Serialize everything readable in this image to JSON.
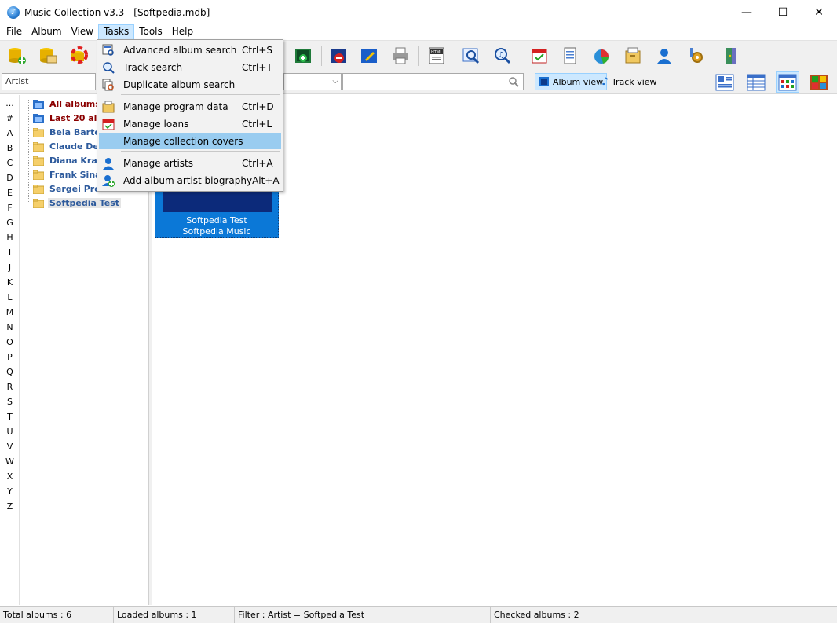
{
  "window": {
    "title": "Music Collection v3.3 - [Softpedia.mdb]",
    "minimize": "—",
    "maximize": "☐",
    "close": "✕"
  },
  "menubar": {
    "items": [
      "File",
      "Album",
      "View",
      "Tasks",
      "Tools",
      "Help"
    ],
    "active": "Tasks"
  },
  "filterbar": {
    "field_value": "Artist",
    "search_placeholder": "",
    "album_view_label": "Album view",
    "track_view_label": "Track view"
  },
  "alphabet": [
    "...",
    "#",
    "A",
    "B",
    "C",
    "D",
    "E",
    "F",
    "G",
    "H",
    "I",
    "J",
    "K",
    "L",
    "M",
    "N",
    "O",
    "P",
    "Q",
    "R",
    "S",
    "T",
    "U",
    "V",
    "W",
    "X",
    "Y",
    "Z"
  ],
  "tree": {
    "items": [
      {
        "label": "All albums",
        "style": "red"
      },
      {
        "label": "Last 20 albu",
        "style": "red"
      },
      {
        "label": "Bela Bartok",
        "style": "blue"
      },
      {
        "label": "Claude Debu",
        "style": "blue"
      },
      {
        "label": "Diana Krall",
        "style": "blue"
      },
      {
        "label": "Frank Sinat",
        "style": "blue"
      },
      {
        "label": "Sergei Prok",
        "style": "blue"
      },
      {
        "label": "Softpedia Test",
        "style": "blue"
      }
    ]
  },
  "album": {
    "title": "Softpedia Test",
    "artist": "Softpedia Music"
  },
  "tasks_menu": {
    "items": [
      {
        "label": "Advanced album search",
        "shortcut": "Ctrl+S",
        "icon": "advanced-search-icon"
      },
      {
        "label": "Track search",
        "shortcut": "Ctrl+T",
        "icon": "track-search-icon"
      },
      {
        "label": "Duplicate album search",
        "shortcut": "",
        "icon": "duplicate-search-icon"
      },
      {
        "label": "Manage program data",
        "shortcut": "Ctrl+D",
        "icon": "program-data-icon"
      },
      {
        "label": "Manage loans",
        "shortcut": "Ctrl+L",
        "icon": "loans-calendar-icon"
      },
      {
        "label": "Manage collection covers",
        "shortcut": "",
        "icon": "none"
      },
      {
        "label": "Manage artists",
        "shortcut": "Ctrl+A",
        "icon": "artist-icon"
      },
      {
        "label": "Add album artist biography",
        "shortcut": "Alt+A",
        "icon": "add-artist-icon"
      }
    ],
    "highlighted": "Manage collection covers"
  },
  "statusbar": {
    "total": "Total albums : 6",
    "loaded": "Loaded albums : 1",
    "filter": "Filter : Artist = Softpedia Test",
    "checked": "Checked albums : 2"
  },
  "colors": {
    "menu_highlight": "#99ccf0",
    "active_toggle": "#cce8ff",
    "album_card": "#0b78d7",
    "album_cover": "#0c2a7a",
    "tree_red": "#8b0000",
    "tree_blue": "#2d5a9c"
  }
}
